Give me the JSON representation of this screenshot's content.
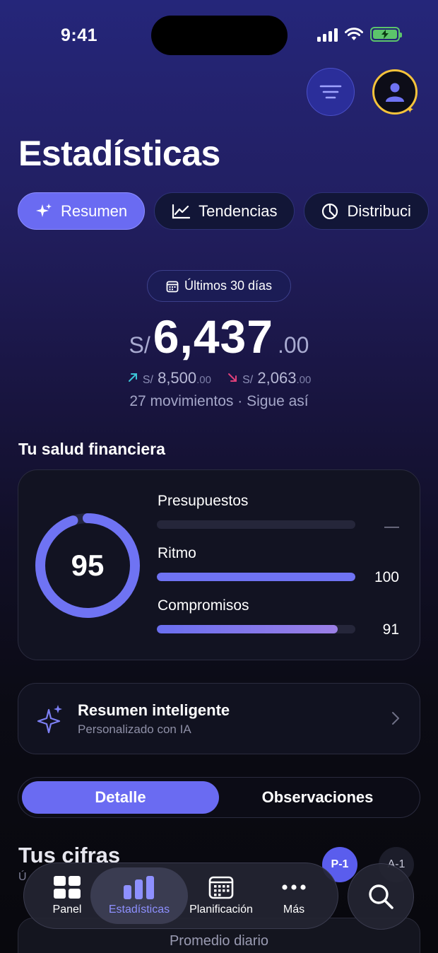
{
  "status_bar": {
    "time": "9:41"
  },
  "page": {
    "title": "Estadísticas"
  },
  "tabs": [
    {
      "label": "Resumen",
      "icon": "sparkles-icon",
      "active": true
    },
    {
      "label": "Tendencias",
      "icon": "trend-chart-icon",
      "active": false
    },
    {
      "label": "Distribuci",
      "icon": "pie-chart-icon",
      "active": false
    }
  ],
  "summary": {
    "period": "Últimos 30 días",
    "currency": "S/",
    "amount": "6,437",
    "decimals": ".00",
    "income": {
      "currency": "S/",
      "amount": "8,500",
      "decimals": ".00"
    },
    "expense": {
      "currency": "S/",
      "amount": "2,063",
      "decimals": ".00"
    },
    "movements": "27 movimientos · Sigue así"
  },
  "health": {
    "title": "Tu salud financiera",
    "score": "95",
    "score_fraction": 0.95,
    "metrics": [
      {
        "label": "Presupuestos",
        "value": "—",
        "fraction": 0
      },
      {
        "label": "Ritmo",
        "value": "100",
        "fraction": 1.0
      },
      {
        "label": "Compromisos",
        "value": "91",
        "fraction": 0.91
      }
    ]
  },
  "smart_summary": {
    "title": "Resumen inteligente",
    "subtitle": "Personalizado con IA"
  },
  "segments": {
    "active": "Detalle",
    "other": "Observaciones"
  },
  "figures": {
    "title": "Tus cifras",
    "subtitle": "Ú",
    "chip_active": "P-1",
    "chip_other": "A-1",
    "daily_label": "Promedio diario"
  },
  "nav": [
    {
      "label": "Panel",
      "icon": "grid-icon",
      "active": false
    },
    {
      "label": "Estadísticas",
      "icon": "bar-chart-icon",
      "active": true
    },
    {
      "label": "Planificación",
      "icon": "calendar-icon",
      "active": false
    },
    {
      "label": "Más",
      "icon": "more-dots-icon",
      "active": false
    }
  ],
  "colors": {
    "accent": "#6a6bf2",
    "income": "#3cc6d8",
    "expense": "#e0407a",
    "gold": "#f5c33b"
  }
}
